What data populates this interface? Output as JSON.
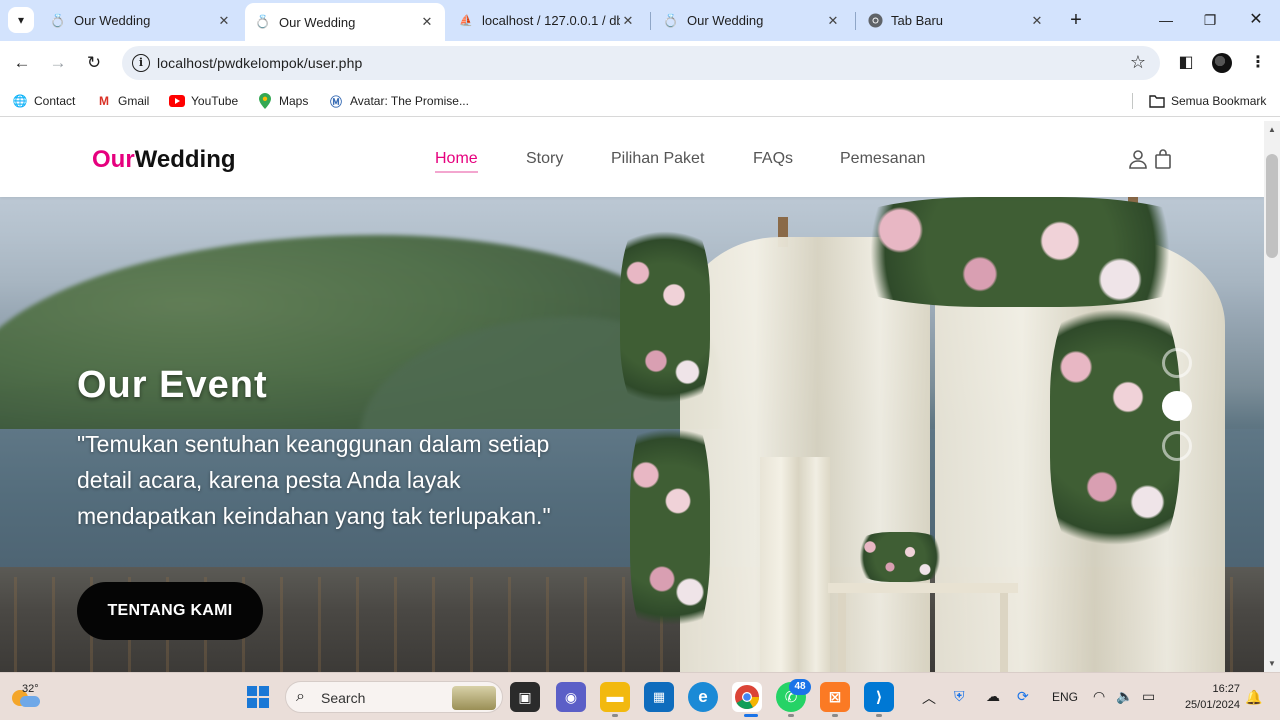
{
  "browser": {
    "tabs": [
      {
        "title": "Our Wedding",
        "favicon": "ring-icon",
        "active": false
      },
      {
        "title": "Our Wedding",
        "favicon": "ring-icon",
        "active": true
      },
      {
        "title": "localhost / 127.0.0.1 / db",
        "favicon": "phpmyadmin-icon",
        "active": false
      },
      {
        "title": "Our Wedding",
        "favicon": "ring-icon",
        "active": false
      },
      {
        "title": "Tab Baru",
        "favicon": "chrome-icon",
        "active": false
      }
    ],
    "url": "localhost/pwdkelompok/user.php",
    "bookmarks": [
      {
        "label": "Contact",
        "icon": "globe-icon"
      },
      {
        "label": "Gmail",
        "icon": "gmail-icon"
      },
      {
        "label": "YouTube",
        "icon": "youtube-icon"
      },
      {
        "label": "Maps",
        "icon": "maps-icon"
      },
      {
        "label": "Avatar: The Promise...",
        "icon": "bookmark-site-icon"
      }
    ],
    "all_bookmarks_label": "Semua Bookmark"
  },
  "site": {
    "logo_accent": "Our",
    "logo_rest": "Wedding",
    "nav": [
      {
        "label": "Home",
        "active": true
      },
      {
        "label": "Story",
        "active": false
      },
      {
        "label": "Pilihan Paket",
        "active": false
      },
      {
        "label": "FAQs",
        "active": false
      },
      {
        "label": "Pemesanan",
        "active": false
      }
    ],
    "accent_color": "#e6007e"
  },
  "hero": {
    "title": "Our Event",
    "text": "\"Temukan sentuhan keanggunan dalam setiap detail acara, karena pesta Anda layak mendapatkan keindahan yang tak terlupakan.\"",
    "button": "TENTANG KAMI",
    "slides": 3,
    "active_slide": 2
  },
  "taskbar": {
    "temperature": "32°",
    "search_label": "Search",
    "whatsapp_badge": "48",
    "language": "ENG",
    "time": "16:27",
    "date": "25/01/2024"
  }
}
